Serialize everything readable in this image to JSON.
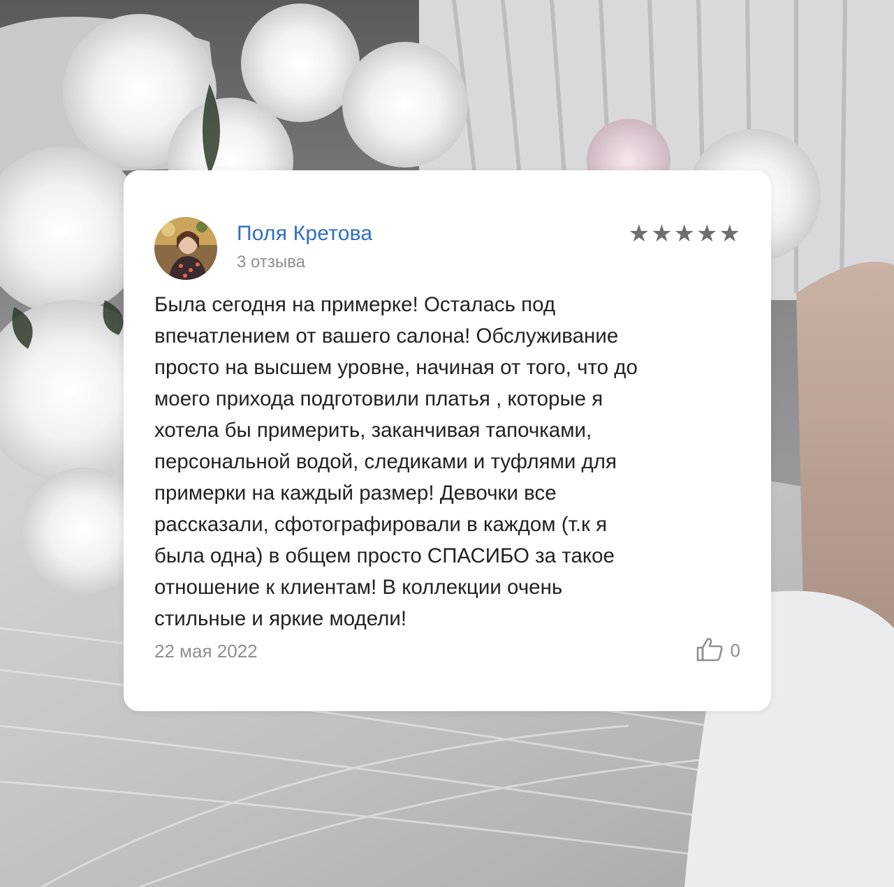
{
  "review": {
    "author_name": "Поля Кретова",
    "author_reviews": "3 отзыва",
    "rating": 5,
    "rating_max": 5,
    "star_glyph": "★",
    "text": "Была сегодня на примерке! Осталась под\nвпечатлением от вашего салона! Обслуживание\nпросто на высшем уровне, начиная от того, что до\nмоего прихода подготовили платья , которые я\nхотела бы примерить, заканчивая тапочками,\nперсональной водой, следиками и туфлями для\nпримерки на каждый размер! Девочки все\nрассказали, сфотографировали в каждом (т.к я\nбыла одна) в общем просто СПАСИБО за такое\nотношение к клиентам! В коллекции очень\nстильные и яркие модели!",
    "date": "22 мая 2022",
    "likes": "0",
    "like_icon": "thumbs-up-icon"
  },
  "colors": {
    "author": "#2f6fc4",
    "muted": "#8f8f8f",
    "text": "#222222",
    "star": "#6f6f6f",
    "card": "#ffffff"
  }
}
